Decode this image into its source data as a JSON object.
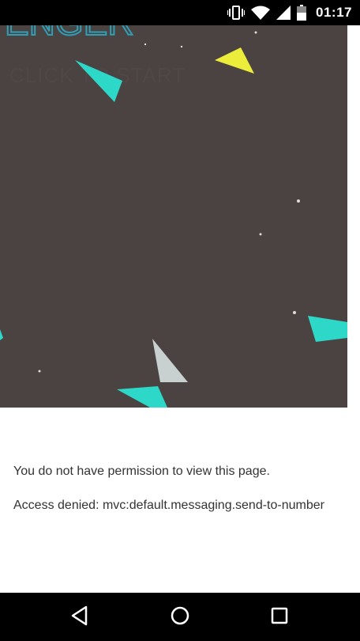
{
  "status_bar": {
    "time": "01:17",
    "icons": [
      "vibrate-icon",
      "wifi-icon",
      "signal-icon",
      "battery-icon"
    ]
  },
  "game": {
    "title_fragment": "ENGER",
    "subtitle_fragment": "CLICK TO START",
    "background_color": "#4b4242",
    "title_color": "#2f9fb5",
    "shape_colors": [
      "#2ed8c8",
      "#ecec3a",
      "#c8d0d0"
    ]
  },
  "message": {
    "line1": "You do not have permission to view this page.",
    "line2": "Access denied: mvc:default.messaging.send-to-number"
  },
  "nav_bar": {
    "icons": [
      "back-icon",
      "home-icon",
      "recents-icon"
    ]
  }
}
